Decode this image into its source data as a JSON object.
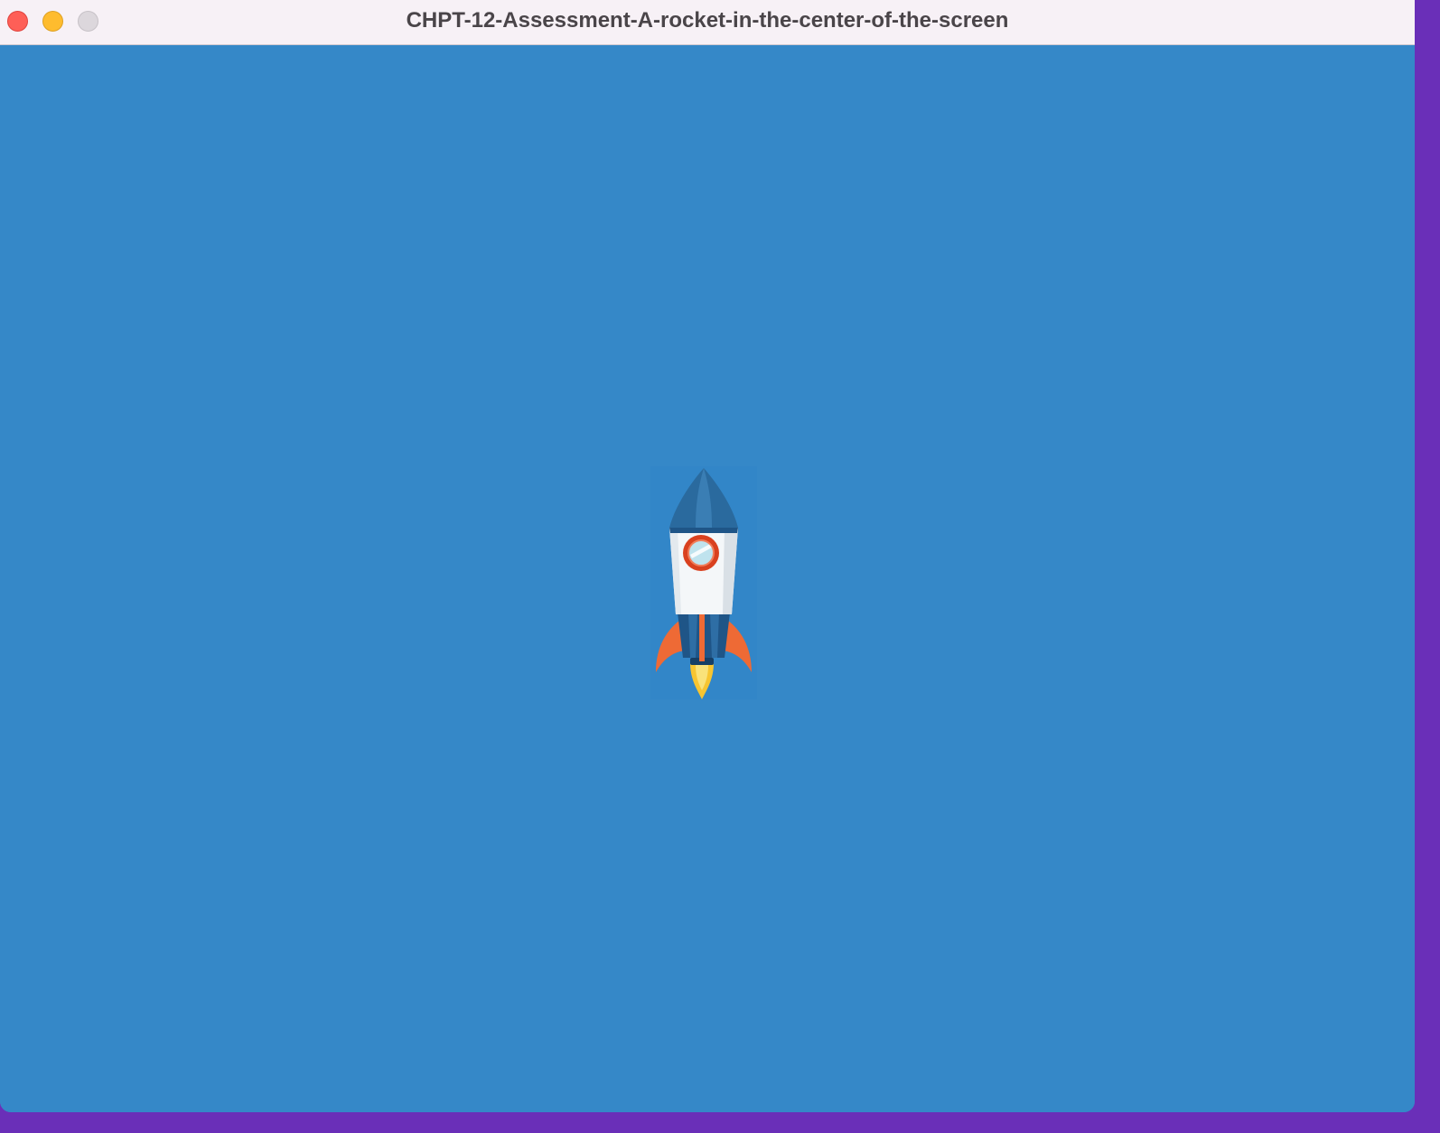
{
  "window": {
    "title": "CHPT-12-Assessment-A-rocket-in-the-center-of-the-screen",
    "controls": [
      "close",
      "minimize",
      "zoom"
    ]
  },
  "canvas": {
    "background_color": "#3588c8",
    "sprite": {
      "name": "rocket",
      "icon": "rocket-icon"
    }
  },
  "colors": {
    "close": "#fe5f57",
    "minimize": "#febc2e",
    "zoom": "#dcd7dc",
    "rocket_nose": "#2a6a9e",
    "rocket_body": "#f4f7f9",
    "rocket_fins": "#ee6a35",
    "flame": "#f7c531"
  }
}
